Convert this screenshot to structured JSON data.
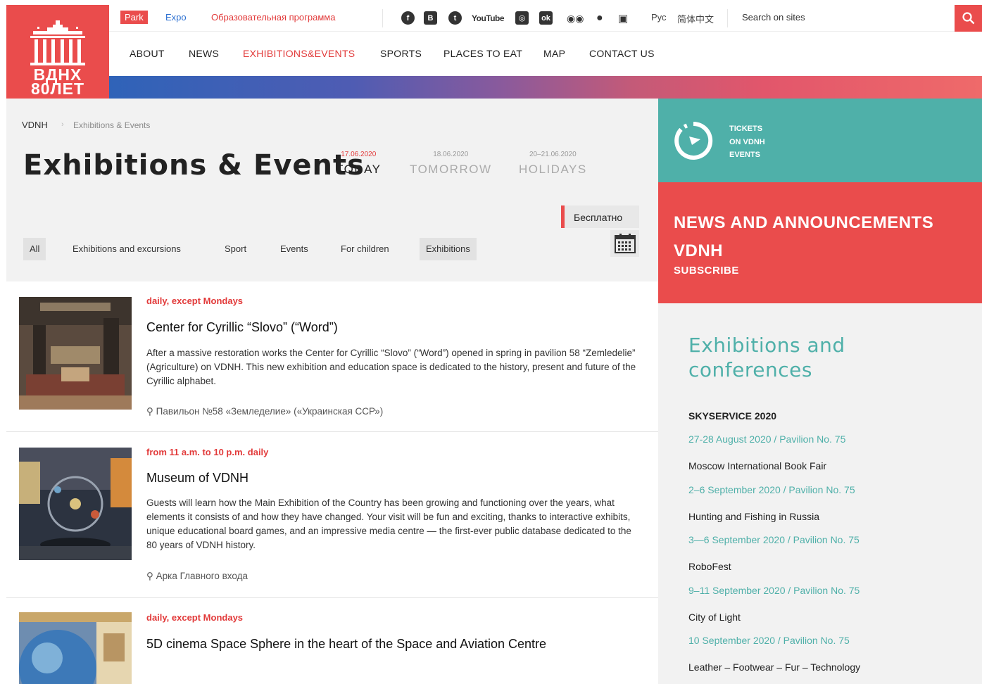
{
  "logo": {
    "line1": "ВДНХ",
    "line2": "80ЛЕТ"
  },
  "topbar": {
    "park": "Park",
    "expo": "Expo",
    "edu": "Образовательная программа",
    "social": [
      "facebook-icon",
      "vk-icon",
      "twitter-icon",
      "youtube-icon",
      "instagram-icon",
      "odnoklassniki-icon",
      "tripadvisor-icon",
      "apple-icon",
      "android-icon"
    ],
    "youtube_label": "YouTube",
    "lang_ru": "Рус",
    "lang_cn": "简体中文",
    "search_placeholder": "Search on sites"
  },
  "nav": {
    "items": [
      "ABOUT",
      "NEWS",
      "EXHIBITIONS&EVENTS",
      "SPORTS",
      "PLACES TO EAT",
      "MAP",
      "CONTACT US"
    ],
    "active": "EXHIBITIONS&EVENTS"
  },
  "breadcrumb": {
    "root": "VDNH",
    "current": "Exhibitions & Events"
  },
  "page_title": "Exhibitions & Events",
  "days": [
    {
      "date": "17.06.2020",
      "label": "TODAY"
    },
    {
      "date": "18.06.2020",
      "label": "TOMORROW"
    },
    {
      "date": "20–21.06.2020",
      "label": "HOLIDAYS"
    }
  ],
  "free_label": "Бесплатно",
  "filters": [
    "All",
    "Exhibitions and excursions",
    "Sport",
    "Events",
    "For children",
    "Exhibitions"
  ],
  "events": [
    {
      "when": "daily, except Mondays",
      "title": "Center for Cyrillic “Slovo” (“Word”)",
      "desc": "After a massive restoration works the Center for Cyrillic “Slovo” (“Word”) opened in spring in pavilion 58 “Zemledelie” (Agriculture) on VDNH. This new exhibition and education space is dedicated to the history, present and future of the Cyrillic alphabet.",
      "location": "Павильон №58 «Земледелие» («Украинская ССР»)"
    },
    {
      "when": "from 11 a.m. to 10 p.m. daily",
      "title": "Museum of VDNH",
      "desc": "Guests will learn how the Main Exhibition of the Country has been growing and functioning over the years, what elements it consists of and how they have changed. Your visit will be fun and exciting, thanks to interactive exhibits, unique educational board games, and an impressive media centre — the first-ever public database dedicated to the 80 years of VDNH history.",
      "location": "Арка Главного входа"
    },
    {
      "when": "daily, except Mondays",
      "title": "5D cinema Space Sphere in the heart of the Space and Aviation Centre"
    }
  ],
  "tickets": {
    "line1": "TICKETS",
    "line2": "ON VDNH",
    "line3": "EVENTS"
  },
  "news": {
    "line1": "NEWS AND ANNOUNCEMENTS",
    "line2": "VDNH",
    "subscribe": "SUBSCRIBE"
  },
  "sidebar": {
    "title1": "Exhibitions and",
    "title2": "conferences",
    "items": [
      {
        "name": "SKYSERVICE 2020",
        "date": "27-28 August 2020 / Pavilion No. 75"
      },
      {
        "name": "Moscow International Book Fair",
        "date": "2–6 September 2020 / Pavilion No. 75"
      },
      {
        "name": "Hunting and Fishing in Russia",
        "date": "3—6 September 2020 / Pavilion No. 75"
      },
      {
        "name": "RoboFest",
        "date": "9–11 September 2020 / Pavilion No. 75"
      },
      {
        "name": "City of Light",
        "date": "10 September 2020 / Pavilion No. 75"
      },
      {
        "name": "Leather – Footwear – Fur – Technology",
        "date": ""
      }
    ]
  },
  "colors": {
    "brand_red": "#ea4c4c",
    "teal": "#4fb0a9"
  }
}
